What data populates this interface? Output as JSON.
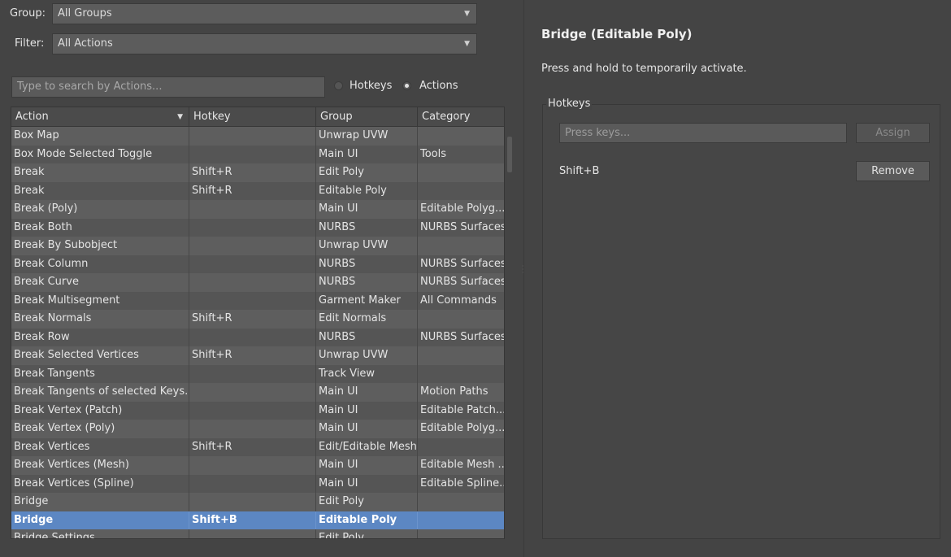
{
  "group": {
    "label": "Group:",
    "value": "All Groups"
  },
  "filter": {
    "label": "Filter:",
    "value": "All Actions"
  },
  "search": {
    "placeholder": "Type to search by Actions..."
  },
  "mode": {
    "hotkeys_label": "Hotkeys",
    "actions_label": "Actions",
    "selected": "Actions"
  },
  "table": {
    "columns": [
      "Action",
      "Hotkey",
      "Group",
      "Category"
    ],
    "rows": [
      [
        "Box Map",
        "",
        "Unwrap UVW",
        ""
      ],
      [
        "Box Mode Selected Toggle",
        "",
        "Main UI",
        "Tools"
      ],
      [
        "Break",
        "Shift+R",
        "Edit Poly",
        ""
      ],
      [
        "Break",
        "Shift+R",
        "Editable Poly",
        ""
      ],
      [
        "Break (Poly)",
        "",
        "Main UI",
        "Editable Polyg..."
      ],
      [
        "Break Both",
        "",
        "NURBS",
        "NURBS Surfaces"
      ],
      [
        "Break By Subobject",
        "",
        "Unwrap UVW",
        ""
      ],
      [
        "Break Column",
        "",
        "NURBS",
        "NURBS Surfaces"
      ],
      [
        "Break Curve",
        "",
        "NURBS",
        "NURBS Surfaces"
      ],
      [
        "Break Multisegment",
        "",
        "Garment Maker",
        "All Commands"
      ],
      [
        "Break Normals",
        "Shift+R",
        "Edit Normals",
        ""
      ],
      [
        "Break Row",
        "",
        "NURBS",
        "NURBS Surfaces"
      ],
      [
        "Break Selected Vertices",
        "Shift+R",
        "Unwrap UVW",
        ""
      ],
      [
        "Break Tangents",
        "",
        "Track View",
        ""
      ],
      [
        "Break Tangents of selected Keys...",
        "",
        "Main UI",
        "Motion Paths"
      ],
      [
        "Break Vertex (Patch)",
        "",
        "Main UI",
        "Editable Patch..."
      ],
      [
        "Break Vertex (Poly)",
        "",
        "Main UI",
        "Editable Polyg..."
      ],
      [
        "Break Vertices",
        "Shift+R",
        "Edit/Editable Mesh",
        ""
      ],
      [
        "Break Vertices (Mesh)",
        "",
        "Main UI",
        "Editable Mesh ..."
      ],
      [
        "Break Vertices (Spline)",
        "",
        "Main UI",
        "Editable Spline..."
      ],
      [
        "Bridge",
        "",
        "Edit Poly",
        ""
      ],
      [
        "Bridge",
        "Shift+B",
        "Editable Poly",
        ""
      ],
      [
        "Bridge Settings",
        "",
        "Edit Poly",
        ""
      ]
    ],
    "selected_index": 21
  },
  "detail": {
    "title": "Bridge (Editable Poly)",
    "description": "Press and hold to temporarily activate.",
    "hotkeys_label": "Hotkeys",
    "press_keys_placeholder": "Press keys...",
    "assign_label": "Assign",
    "current_hotkey": "Shift+B",
    "remove_label": "Remove"
  }
}
